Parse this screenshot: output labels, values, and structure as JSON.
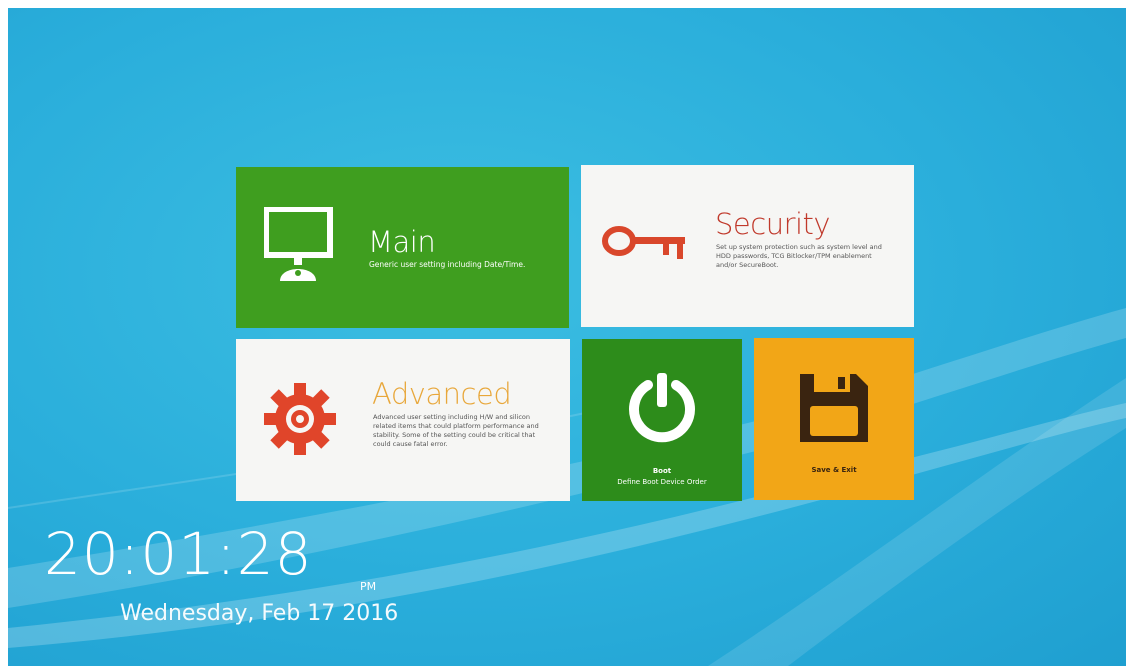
{
  "tiles": {
    "main": {
      "title": "Main",
      "description": "Generic user setting including Date/Time.",
      "icon": "monitor-icon",
      "color": "#3f9e1f"
    },
    "security": {
      "title": "Security",
      "description": "Set up system protection such as system level and HDD passwords, TCG Bitlocker/TPM enablement and/or SecureBoot.",
      "icon": "key-icon",
      "color": "#c0392b"
    },
    "advanced": {
      "title": "Advanced",
      "description": "Advanced user setting including H/W and silicon related items that could platform performance and stability. Some of the setting could be critical that could cause fatal error.",
      "icon": "gear-icon",
      "color": "#e8a73a"
    },
    "boot": {
      "title": "Boot",
      "description": "Define Boot Device Order",
      "icon": "power-icon",
      "color": "#2d8c1b"
    },
    "save_exit": {
      "title": "Save & Exit",
      "icon": "floppy-disk-icon",
      "color": "#f2a617"
    }
  },
  "clock": {
    "time": "20:01:28",
    "ampm": "PM",
    "date": "Wednesday, Feb 17 2016"
  }
}
